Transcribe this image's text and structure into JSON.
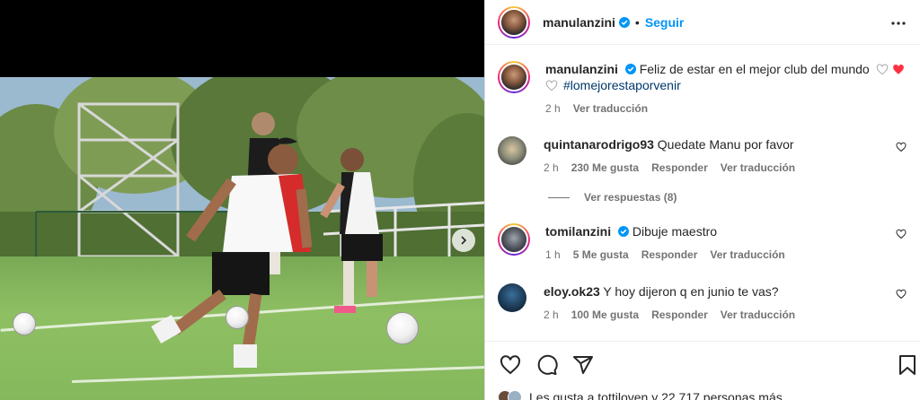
{
  "post": {
    "author": "manulanzini",
    "follow_label": "Seguir",
    "separator": "•"
  },
  "caption": {
    "username": "manulanzini",
    "text": "Feliz de estar en el mejor club del mundo",
    "hashtag": "#lomejorestaporvenir",
    "time": "2 h",
    "translate": "Ver traducción"
  },
  "comments": [
    {
      "username": "quintanarodrigo93",
      "text": "Quedate Manu por favor",
      "time": "2 h",
      "likes": "230 Me gusta",
      "reply": "Responder",
      "translate": "Ver traducción"
    },
    {
      "username": "tomilanzini",
      "text": "Dibuje maestro",
      "time": "1 h",
      "likes": "5 Me gusta",
      "reply": "Responder",
      "translate": "Ver traducción"
    },
    {
      "username": "eloy.ok23",
      "text": "Y hoy dijeron q en junio te vas?",
      "time": "2 h",
      "likes": "100 Me gusta",
      "reply": "Responder",
      "translate": "Ver traducción"
    }
  ],
  "view_replies": "Ver respuestas (8)",
  "likes_line": "Les gusta a tottiloven y 22.717 personas más",
  "icons": {
    "more": "more-options-icon",
    "verified": "verified-badge-icon",
    "like": "heart-icon",
    "comment": "comment-icon",
    "share": "share-icon",
    "save": "bookmark-icon",
    "next": "chevron-right-icon"
  },
  "colors": {
    "link": "#0095f6",
    "hashtag": "#00376b",
    "secondary": "#737373",
    "heart_red": "#ff3040"
  }
}
